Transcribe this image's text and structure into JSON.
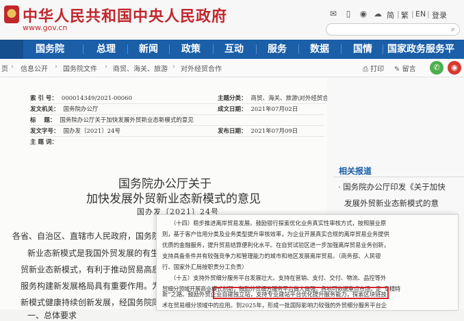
{
  "header": {
    "title": "中华人民共和国中央人民政府",
    "url": "www.gov.cn",
    "links": {
      "simplified": "简",
      "traditional": "繁",
      "english": "EN",
      "login": "登录"
    }
  },
  "nav": {
    "items": [
      "国务院",
      "总理",
      "新闻",
      "政策",
      "互动",
      "服务",
      "数据",
      "国情",
      "国家政务服务平"
    ]
  },
  "breadcrumb": {
    "items": [
      "页",
      "信息公开",
      "国务院文件",
      "商贸、海关、旅游",
      "对外经贸合作"
    ],
    "separator": "›"
  },
  "tools": {
    "print": "打印",
    "comment": "留言"
  },
  "meta": {
    "index_label": "索 引 号：",
    "index_value": "000014349/2021-00060",
    "category_label": "主题分类：",
    "category_value": "商贸、海关、旅游\\对外经贸合作",
    "issuer_label": "发文机关：",
    "issuer_value": "国务院办公厅",
    "written_label": "成文日期：",
    "written_value": "2021年07月02日",
    "title_label": "标    题：",
    "title_value": "国务院办公厅关于加快发展外贸新业态新模式的意见",
    "doc_no_label": "发文字号：",
    "doc_no_value": "国办发〔2021〕24号",
    "published_label": "发布日期：",
    "published_value": "2021年07月09日",
    "subject_label": "主 题 词："
  },
  "document": {
    "title_line1": "国务院办公厅关于",
    "title_line2": "加快发展外贸新业态新模式的意见",
    "number": "国办发〔2021〕24号",
    "body": [
      "各省、自治区、直辖市人民政府，国务院各",
      "新业态新模式是我国外贸发展的有生力",
      "贸新业态新模式，有利于推动贸易高质量发",
      "服务构建新发展格局具有重要作用。为深入",
      "新模式健康持续创新发展，经国务院同意，",
      "一、总体要求"
    ]
  },
  "related": {
    "title": "相关报道",
    "item_line1": "· 国务院办公厅印发《关于加快",
    "item_line2": "发展外贸新业态新模式的意"
  },
  "inset": {
    "lines": [
      "（十四）稳步推进离岸贸易发展。鼓励银行探索优化业务真实性审核方式，按照展业原",
      "则，基于客户信用分类及业务类型提升审核效率，为企业开展真实合规的离岸贸易业务提供",
      "优质的金融服务，提升贸易结算便利化水平。在自贸试验区进一步加强离岸贸易业务创新，",
      "支持具备条件并有较强竞争力和管理能力的城市和地区发展离岸贸易。（商务部、人民银",
      "行、国家外汇局按职责分工负责）",
      "（十五）支持外贸细分服务平台发展壮大。支持在营销、支付、交付、物流、品控等外",
      "贸细分领域开展商业模式创新，鼓励外贸细分服务平台做大做强，各地可依据重点市场，走“专精特",
      "新”之路。鼓励外贸企业自建独立站，支持专业建站平台优化提升服务能力，探索区块链技",
      "术在贸易细分领域中的应用。到2025年，形成一批国际影响力较强的外贸细分服务平台企"
    ]
  },
  "colors": {
    "brand_red": "#c0272d",
    "nav_blue": "#1a5fa8",
    "highlight_red": "#d3242a",
    "link_blue": "#1a5fa8"
  }
}
